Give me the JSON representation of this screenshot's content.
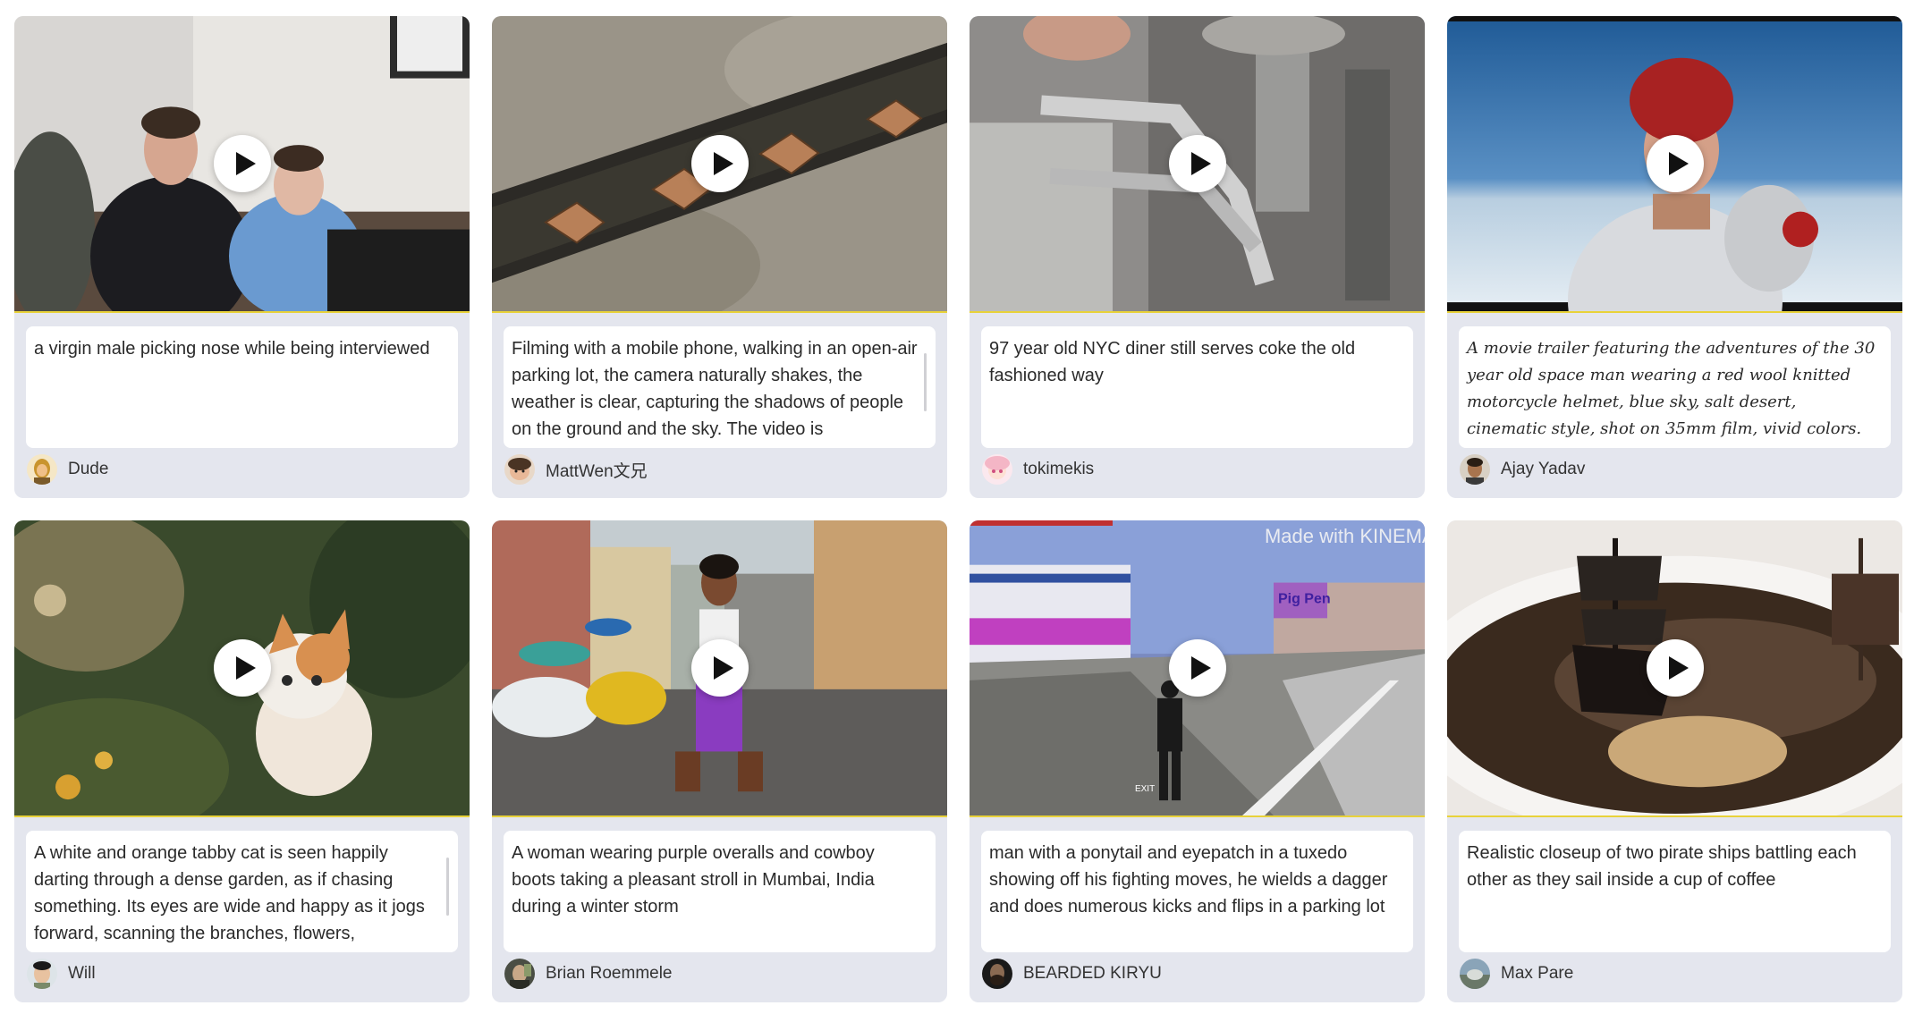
{
  "cards": [
    {
      "prompt": "a virgin male picking nose while being interviewed",
      "author": "Dude"
    },
    {
      "prompt": "Filming with a mobile phone, walking in an open-air parking lot, the camera naturally shakes, the weather is clear, capturing the shadows of people on the ground and the sky. The video is",
      "author": "MattWen文兄"
    },
    {
      "prompt": "97 year old NYC diner still serves coke the old fashioned way",
      "author": "tokimekis"
    },
    {
      "prompt": "A movie trailer featuring the adventures of the 30 year old space man wearing a red wool knitted motorcycle helmet, blue sky, salt desert, cinematic style, shot on 35mm film, vivid colors.",
      "author": "Ajay Yadav"
    },
    {
      "prompt": "A white and orange tabby cat is seen happily darting through a dense garden, as if chasing something. Its eyes are wide and happy as it jogs forward, scanning the branches, flowers,",
      "author": "Will"
    },
    {
      "prompt": "A woman wearing purple overalls and cowboy boots taking a pleasant stroll in Mumbai, India during a winter storm",
      "author": "Brian Roemmele"
    },
    {
      "prompt": "man with a ponytail and eyepatch in a tuxedo showing off his fighting moves, he wields a dagger and does numerous kicks and flips in a parking lot",
      "author": "BEARDED KIRYU"
    },
    {
      "prompt": "Realistic closeup of two pirate ships battling each other as they sail inside a cup of coffee",
      "author": "Max Pare"
    }
  ],
  "thumbnail_overlay_text": {
    "game_watermark": "Made with KINEMAS",
    "game_sign": "Pig Pen",
    "game_exit": "EXIT"
  },
  "icons": {
    "play": "play-icon"
  }
}
